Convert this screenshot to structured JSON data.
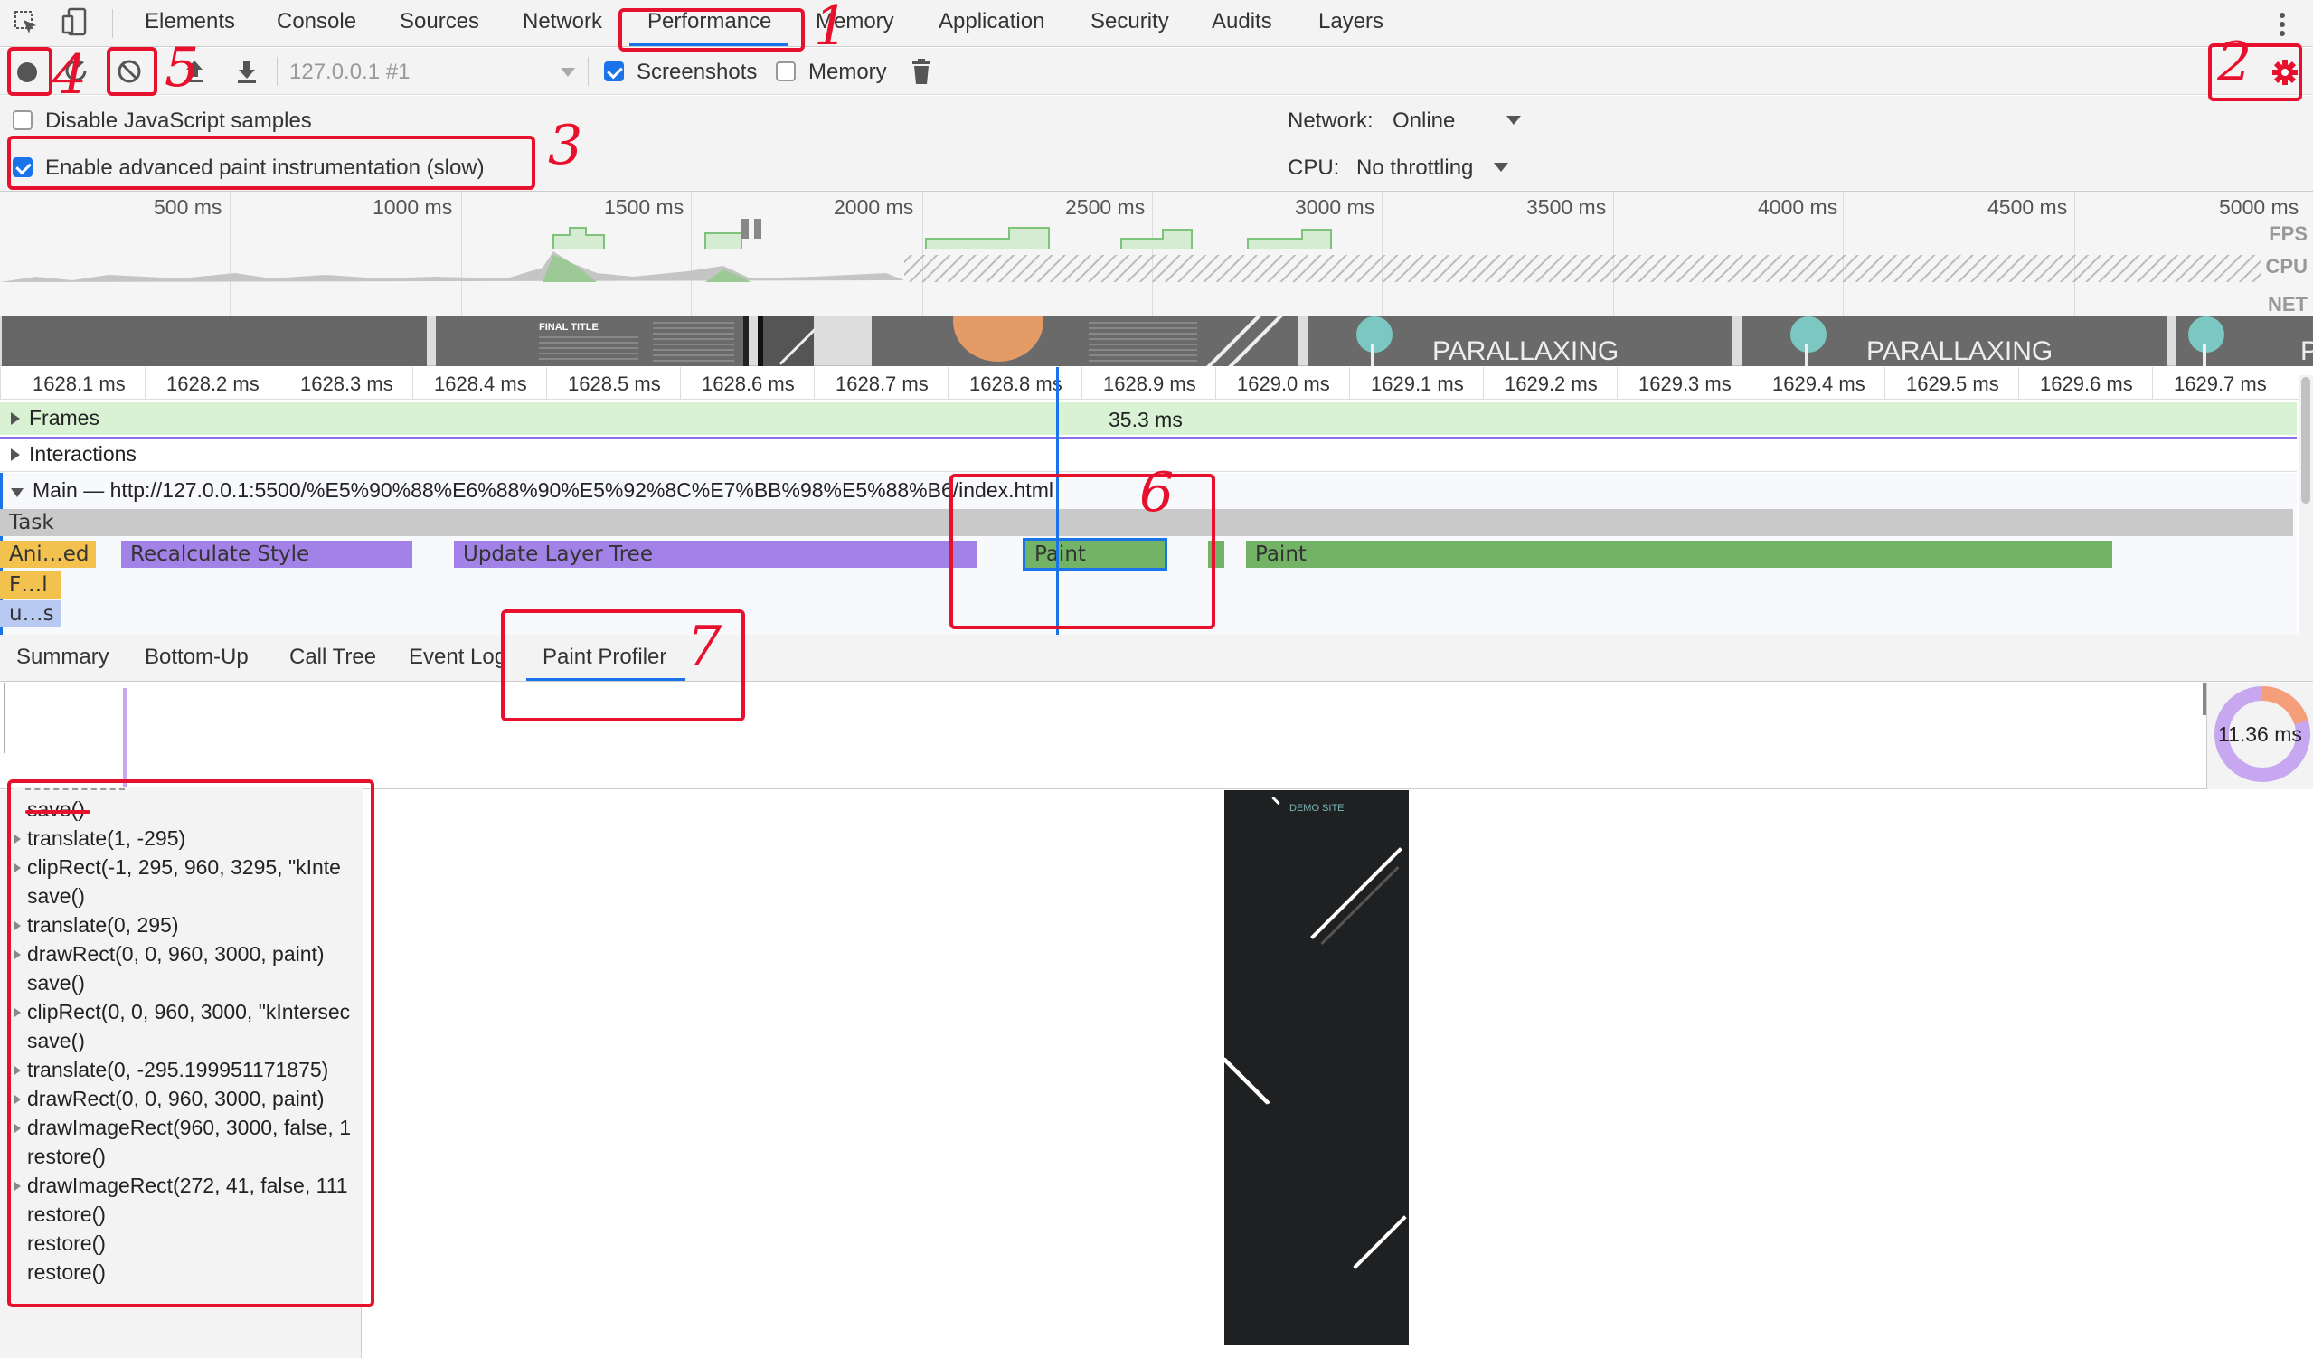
{
  "tabs": [
    "Elements",
    "Console",
    "Sources",
    "Network",
    "Performance",
    "Memory",
    "Application",
    "Security",
    "Audits",
    "Layers"
  ],
  "active_tab": "Performance",
  "toolbar": {
    "target": "127.0.0.1 #1",
    "screenshots_label": "Screenshots",
    "memory_label": "Memory"
  },
  "settings": {
    "disable_js_label": "Disable JavaScript samples",
    "advanced_paint_label": "Enable advanced paint instrumentation (slow)",
    "network_label": "Network:",
    "network_value": "Online",
    "cpu_label": "CPU:",
    "cpu_value": "No throttling"
  },
  "overview": {
    "ticks": [
      "500 ms",
      "1000 ms",
      "1500 ms",
      "2000 ms",
      "2500 ms",
      "3000 ms",
      "3500 ms",
      "4000 ms",
      "4500 ms",
      "5000 ms"
    ],
    "lanes": [
      "FPS",
      "CPU",
      "NET"
    ]
  },
  "filmstrip": {
    "titles": [
      "FINAL TITLE",
      "PARALLAXING",
      "PARALLAXING",
      "P"
    ]
  },
  "ruler": [
    "1628.1 ms",
    "1628.2 ms",
    "1628.3 ms",
    "1628.4 ms",
    "1628.5 ms",
    "1628.6 ms",
    "1628.7 ms",
    "1628.8 ms",
    "1628.9 ms",
    "1629.0 ms",
    "1629.1 ms",
    "1629.2 ms",
    "1629.3 ms",
    "1629.4 ms",
    "1629.5 ms",
    "1629.6 ms",
    "1629.7 ms"
  ],
  "tracks": {
    "frames_label": "Frames",
    "frame_duration": "35.3 ms",
    "interactions_label": "Interactions",
    "main_label": "Main — http://127.0.0.1:5500/%E5%90%88%E6%88%90%E5%92%8C%E7%BB%98%E5%88%B6/index.html",
    "task_label": "Task",
    "events": {
      "animation": "Ani…ed",
      "recalc": "Recalculate Style",
      "layer_tree": "Update Layer Tree",
      "paint1": "Paint",
      "paint2": "Paint",
      "fl": "F…l",
      "us": "u…s"
    }
  },
  "bottom_tabs": [
    "Summary",
    "Bottom-Up",
    "Call Tree",
    "Event Log",
    "Paint Profiler"
  ],
  "active_bottom_tab": "Paint Profiler",
  "profiler": {
    "total_time": "11.36 ms",
    "commands": [
      {
        "text": "save()",
        "expandable": false
      },
      {
        "text": "translate(1, -295)",
        "expandable": true
      },
      {
        "text": "clipRect(-1, 295, 960, 3295, \"kInte",
        "expandable": true
      },
      {
        "text": "save()",
        "expandable": false
      },
      {
        "text": "translate(0, 295)",
        "expandable": true
      },
      {
        "text": "drawRect(0, 0, 960, 3000, paint)",
        "expandable": true
      },
      {
        "text": "save()",
        "expandable": false
      },
      {
        "text": "clipRect(0, 0, 960, 3000, \"kIntersec",
        "expandable": true
      },
      {
        "text": "save()",
        "expandable": false
      },
      {
        "text": "translate(0, -295.199951171875)",
        "expandable": true
      },
      {
        "text": "drawRect(0, 0, 960, 3000, paint)",
        "expandable": true
      },
      {
        "text": "drawImageRect(960, 3000, false, 1",
        "expandable": true
      },
      {
        "text": "restore()",
        "expandable": false
      },
      {
        "text": "drawImageRect(272, 41, false, 111",
        "expandable": true
      },
      {
        "text": "restore()",
        "expandable": false
      },
      {
        "text": "restore()",
        "expandable": false
      },
      {
        "text": "restore()",
        "expandable": false
      }
    ],
    "preview_label": "DEMO SITE"
  },
  "annotations": [
    "1",
    "2",
    "3",
    "4",
    "5",
    "6",
    "7"
  ],
  "colors": {
    "accent": "#1a73e8",
    "annotation_red": "#e8112d",
    "scripting": "#f2c14e",
    "rendering": "#a382e8",
    "painting": "#73b366"
  }
}
